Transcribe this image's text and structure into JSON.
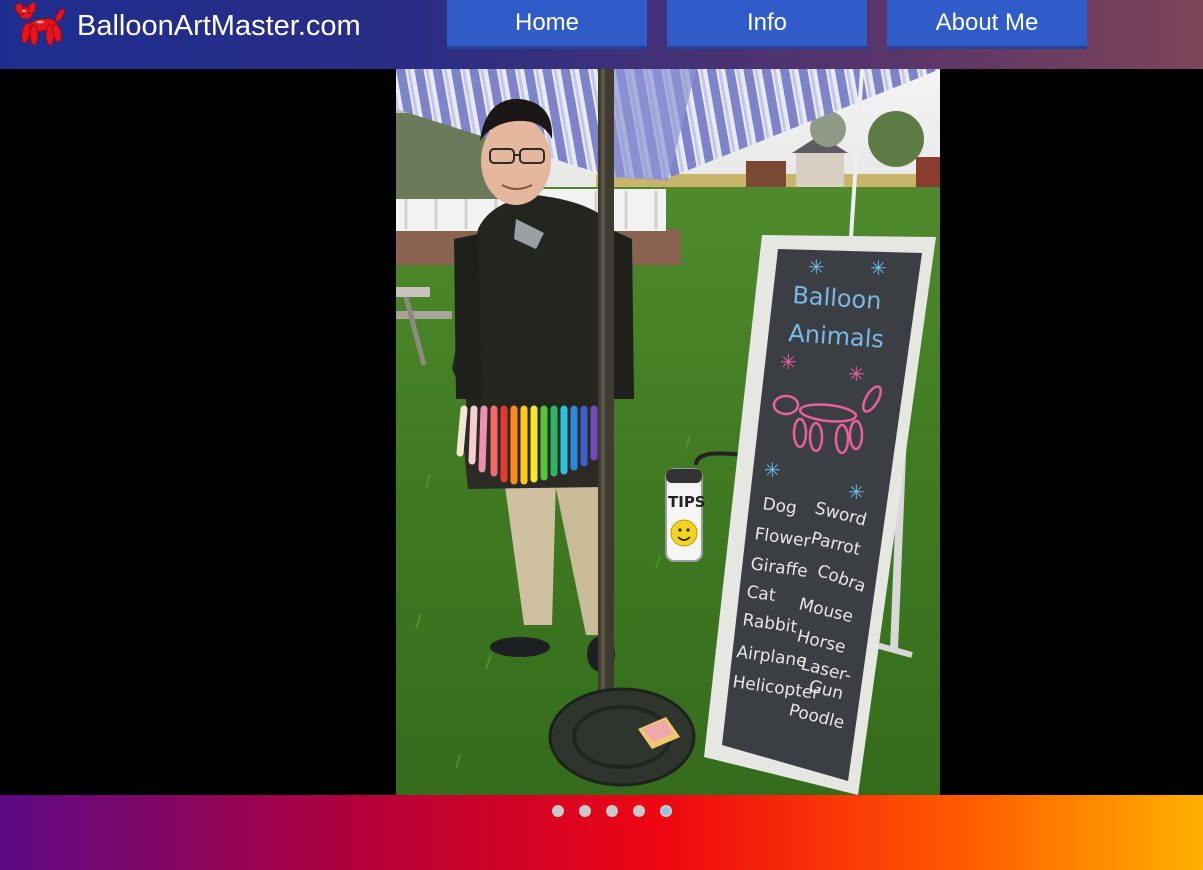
{
  "header": {
    "site_title": "BalloonArtMaster.com",
    "logo_icon": "red-balloon-dog-icon",
    "nav": [
      {
        "label": "Home"
      },
      {
        "label": "Info"
      },
      {
        "label": "About Me"
      }
    ]
  },
  "slideshow": {
    "slide_count": 5,
    "active_index": 4,
    "photo": {
      "sign": {
        "heading": [
          "Balloon",
          "Animals"
        ],
        "items_left": [
          "Dog",
          "Flower",
          "Giraffe",
          "Cat",
          "Rabbit",
          "Airplane",
          "Helicopter"
        ],
        "items_right": [
          "Sword",
          "Parrot",
          "Cobra",
          "Mouse",
          "Horse",
          "Laser-",
          "Gun",
          "Poodle"
        ]
      },
      "tip_jar_label": "TIPS"
    }
  },
  "colors": {
    "nav_button": "#2f5cc9",
    "dot_inactive": "#c9c9c9",
    "dot_active": "#8fc0e6"
  }
}
